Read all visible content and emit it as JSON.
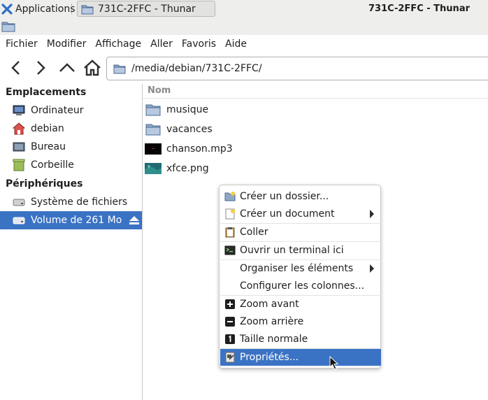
{
  "panel": {
    "applications_label": "Applications",
    "task_label": "731C-2FFC - Thunar"
  },
  "window": {
    "title": "731C-2FFC - Thunar"
  },
  "menubar": {
    "items": [
      "Fichier",
      "Modifier",
      "Affichage",
      "Aller",
      "Favoris",
      "Aide"
    ]
  },
  "toolbar": {
    "location_path": "/media/debian/731C-2FFC/",
    "buttons": [
      "back-icon",
      "forward-icon",
      "up-icon",
      "home-icon"
    ]
  },
  "sidebar": {
    "sections": [
      {
        "title": "Emplacements",
        "items": [
          {
            "label": "Ordinateur",
            "icon": "computer-icon"
          },
          {
            "label": "debian",
            "icon": "home-folder-icon"
          },
          {
            "label": "Bureau",
            "icon": "desktop-icon"
          },
          {
            "label": "Corbeille",
            "icon": "trash-icon"
          }
        ]
      },
      {
        "title": "Périphériques",
        "items": [
          {
            "label": "Système de fichiers",
            "icon": "drive-icon"
          },
          {
            "label": "Volume de 261 Mo",
            "icon": "removable-drive-icon",
            "selected": true
          }
        ]
      }
    ]
  },
  "filelist": {
    "column_name": "Nom",
    "files": [
      {
        "name": "musique",
        "icon": "folder-icon"
      },
      {
        "name": "vacances",
        "icon": "folder-icon"
      },
      {
        "name": "chanson.mp3",
        "icon": "audio-file-icon"
      },
      {
        "name": "xfce.png",
        "icon": "image-file-icon"
      }
    ]
  },
  "context_menu": {
    "items": [
      {
        "label": "Créer un dossier...",
        "icon": "new-folder-icon"
      },
      {
        "label": "Créer un document",
        "icon": "new-document-icon",
        "submenu": true
      },
      {
        "label": "Coller",
        "icon": "paste-icon"
      },
      {
        "label": "Ouvrir un terminal ici",
        "icon": "terminal-icon"
      },
      {
        "label": "Organiser les éléments",
        "submenu": true
      },
      {
        "label": "Configurer les colonnes..."
      },
      {
        "label": "Zoom avant",
        "icon": "zoom-in-icon"
      },
      {
        "label": "Zoom arrière",
        "icon": "zoom-out-icon"
      },
      {
        "label": "Taille normale",
        "icon": "zoom-normal-icon"
      },
      {
        "label": "Propriétés...",
        "icon": "properties-icon",
        "selected": true
      }
    ]
  },
  "colors": {
    "selection": "#3b73c4",
    "panel_bg": "#eeeeec"
  }
}
